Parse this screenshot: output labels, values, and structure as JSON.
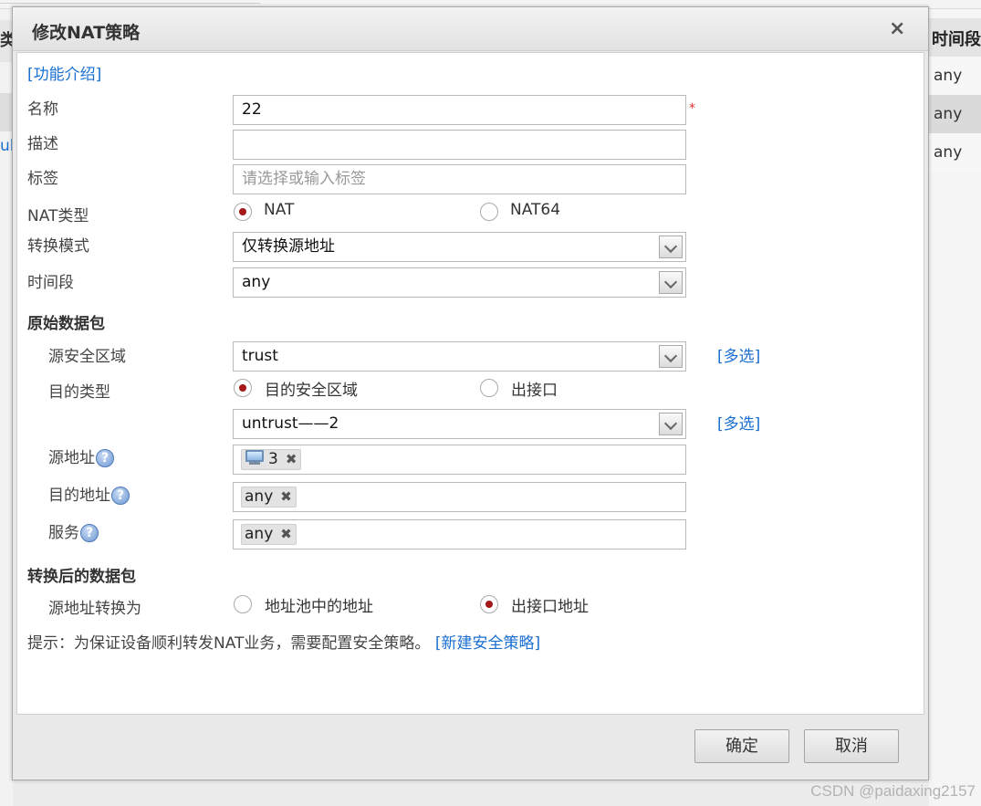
{
  "background": {
    "left_header": "类",
    "left_link": "ul",
    "right_header": "时间段",
    "right_cells": [
      "any",
      "any",
      "any"
    ]
  },
  "watermark": "CSDN @paidaxing2157",
  "dialog": {
    "title": "修改NAT策略",
    "close": "×",
    "intro_link": "[功能介绍]",
    "required_mark": "*",
    "name": {
      "label": "名称",
      "value": "22"
    },
    "description": {
      "label": "描述",
      "value": ""
    },
    "tags": {
      "label": "标签",
      "placeholder": "请选择或输入标签"
    },
    "nat_type": {
      "label": "NAT类型",
      "options": [
        "NAT",
        "NAT64"
      ],
      "selected": "NAT"
    },
    "convert_mode": {
      "label": "转换模式",
      "value": "仅转换源地址"
    },
    "time_range": {
      "label": "时间段",
      "value": "any"
    },
    "original_packet": {
      "section": "原始数据包",
      "src_zone": {
        "label": "源安全区域",
        "value": "trust",
        "multi": "[多选]"
      },
      "dst_type": {
        "label": "目的类型",
        "options": [
          "目的安全区域",
          "出接口"
        ],
        "selected": "目的安全区域"
      },
      "dst_zone": {
        "value": "untrust——2",
        "multi": "[多选]"
      },
      "src_addr": {
        "label": "源地址",
        "tag": "3",
        "icon": "computer-icon"
      },
      "dst_addr": {
        "label": "目的地址",
        "tag": "any"
      },
      "service": {
        "label": "服务",
        "tag": "any"
      }
    },
    "translated_packet": {
      "section": "转换后的数据包",
      "src_convert": {
        "label": "源地址转换为",
        "options": [
          "地址池中的地址",
          "出接口地址"
        ],
        "selected": "出接口地址"
      }
    },
    "tip": {
      "text": "提示：为保证设备顺利转发NAT业务，需要配置安全策略。",
      "link": "[新建安全策略]"
    },
    "buttons": {
      "ok": "确定",
      "cancel": "取消"
    },
    "help_glyph": "?",
    "remove_glyph": "✖"
  }
}
